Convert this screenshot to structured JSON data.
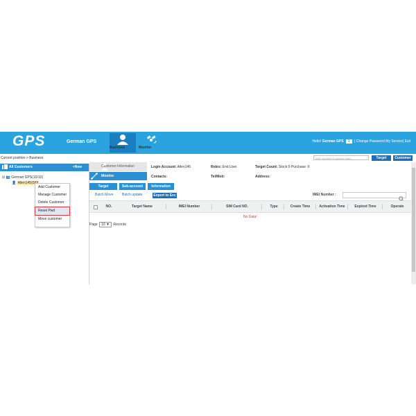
{
  "header": {
    "logo": "GPS",
    "company": "German GPS",
    "nav": [
      {
        "label": "Business",
        "icon": "user-icon",
        "active": true
      },
      {
        "label": "Monitor",
        "icon": "satellite-icon",
        "active": false
      }
    ],
    "hello_prefix": "Hello!",
    "user": "German GPS",
    "badge": "1",
    "links": "[ Change Password  My Service] Exit"
  },
  "toolbar": {
    "breadcrumb": "Current position-> Business",
    "search_placeholder": "IMEI Number/Customer Nam",
    "target_button": "Target",
    "customer_button": "Customer"
  },
  "left": {
    "title": "All Customers",
    "new_button": "+New",
    "tree_root": "German GPS(10/10)",
    "tree_child": "Allen145(0/0)",
    "context_menu": [
      "Add Customer",
      "Manage Customer",
      "Delete Customer",
      "Reset Pwd",
      "Move customer"
    ]
  },
  "detail": {
    "customer_info_tab": "Customer Information",
    "monitor_tab": "Monitor",
    "login_account_label": "Login Account:",
    "login_account_value": "Allen145",
    "roles_label": "Roles:",
    "roles_value": "End User",
    "target_count_label": "Target Count:",
    "target_count_value": "Stock:0 Purchase :0",
    "contacts_label": "Contacts:",
    "tel_label": "Tel/Mob:",
    "address_label": "Address:",
    "tabs": [
      "Target",
      "Sub-account",
      "Information"
    ],
    "actions": [
      "Batch Move",
      "Batch update"
    ],
    "export_button": "Export to Exc",
    "imei_label": "IMEI Number :",
    "columns": [
      "NO.",
      "Target Name",
      "IMEI Number",
      "SIM Card NO.",
      "Type",
      "Create Time",
      "Activation Time",
      "Expired Time",
      "Operate"
    ],
    "no_data": "No Data!",
    "pager_prefix": "Page",
    "page_size": "10",
    "pager_suffix": "Records"
  },
  "colors": {
    "header_bg": "#2ba3df",
    "accent": "#2b8fd4",
    "dark_accent": "#1e6fb4",
    "highlight_border": "#e03030"
  }
}
